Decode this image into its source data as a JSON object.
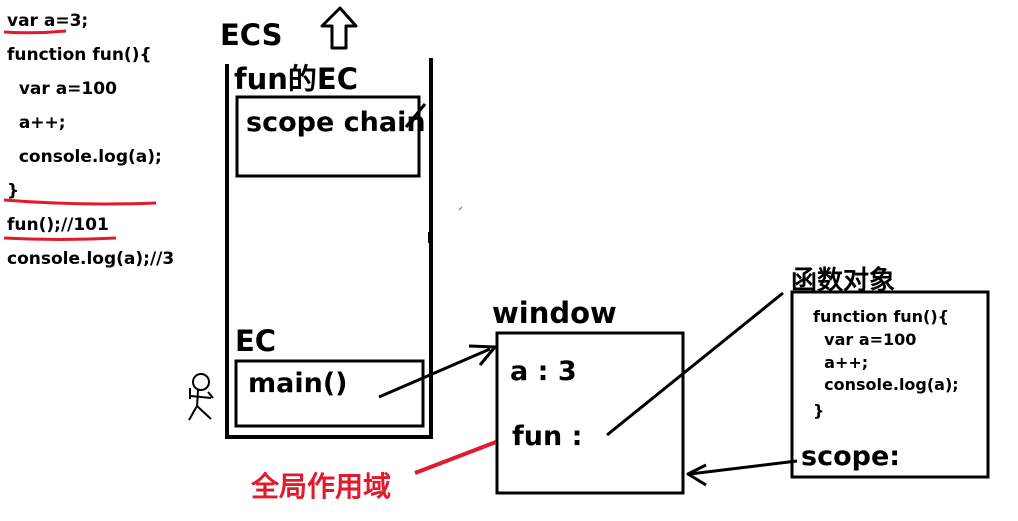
{
  "code": {
    "lines": [
      "var a=3;",
      "function fun(){",
      "  var a=100",
      "  a++;",
      "  console.log(a);",
      "}",
      "fun();//101",
      "console.log(a);//3"
    ]
  },
  "ecs": {
    "title": "ECS",
    "fun_ec_label": "fun的EC",
    "scope_chain_label": "scope chain",
    "ec_label": "EC",
    "main_label": "main()"
  },
  "window": {
    "title": "window",
    "var_a": "a : 3",
    "var_fun": "fun :"
  },
  "function_object": {
    "title": "函数对象",
    "code_lines": [
      "function fun(){",
      "  var a=100",
      "  a++;",
      "  console.log(a);",
      "}"
    ],
    "scope_label": "scope:"
  },
  "global_scope_label": "全局作用域",
  "colors": {
    "ink": "#000000",
    "annotation": "#e11a2c"
  }
}
